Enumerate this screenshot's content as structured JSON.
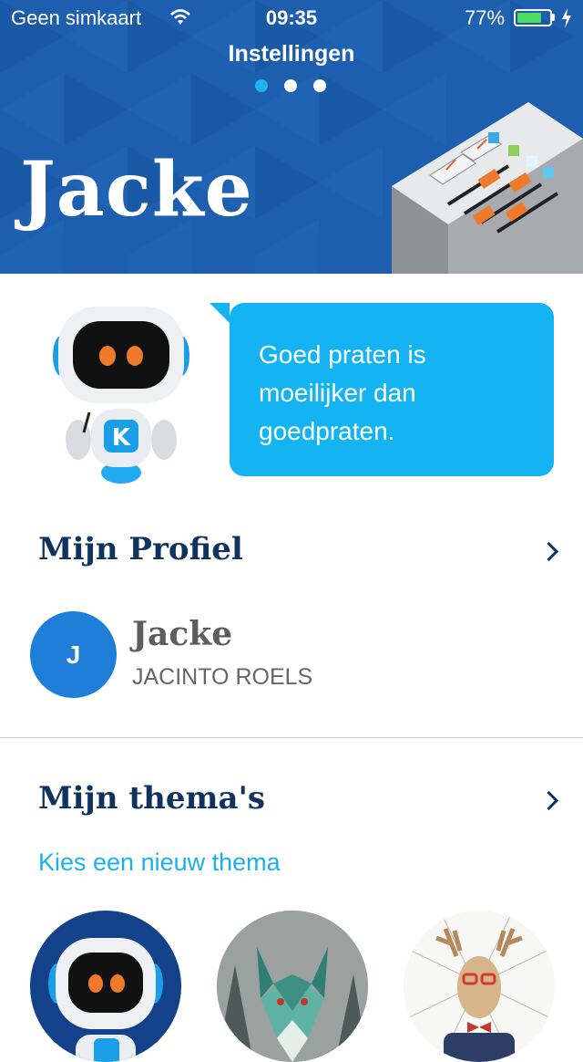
{
  "status_bar": {
    "carrier": "Geen simkaart",
    "time": "09:35",
    "battery_pct": "77%",
    "battery_level": 0.77
  },
  "header": {
    "title": "Instellingen",
    "page_count": 3,
    "active_page": 1,
    "name": "Jacke",
    "bg_color": "#1d5fae"
  },
  "quote": {
    "text_lines": [
      "Goed praten is",
      "moeilijker dan",
      "goedpraten."
    ],
    "bubble_color": "#14b4f2"
  },
  "profile": {
    "section_title": "Mijn Profiel",
    "avatar_initial": "J",
    "nickname": "Jacke",
    "full_name": "JACINTO ROELS"
  },
  "themes": {
    "section_title": "Mijn thema's",
    "choose_link": "Kies een nieuw thema",
    "items": [
      {
        "name": "robot-theme"
      },
      {
        "name": "wolf-theme"
      },
      {
        "name": "deer-theme"
      }
    ]
  },
  "icons": {
    "wifi": "wifi-icon",
    "battery": "battery-icon",
    "charging": "charging-bolt-icon",
    "chevron": "chevron-right-icon"
  },
  "colors": {
    "navy": "#10325f",
    "accent": "#1bb0ec",
    "avatar": "#1e7ed8"
  }
}
